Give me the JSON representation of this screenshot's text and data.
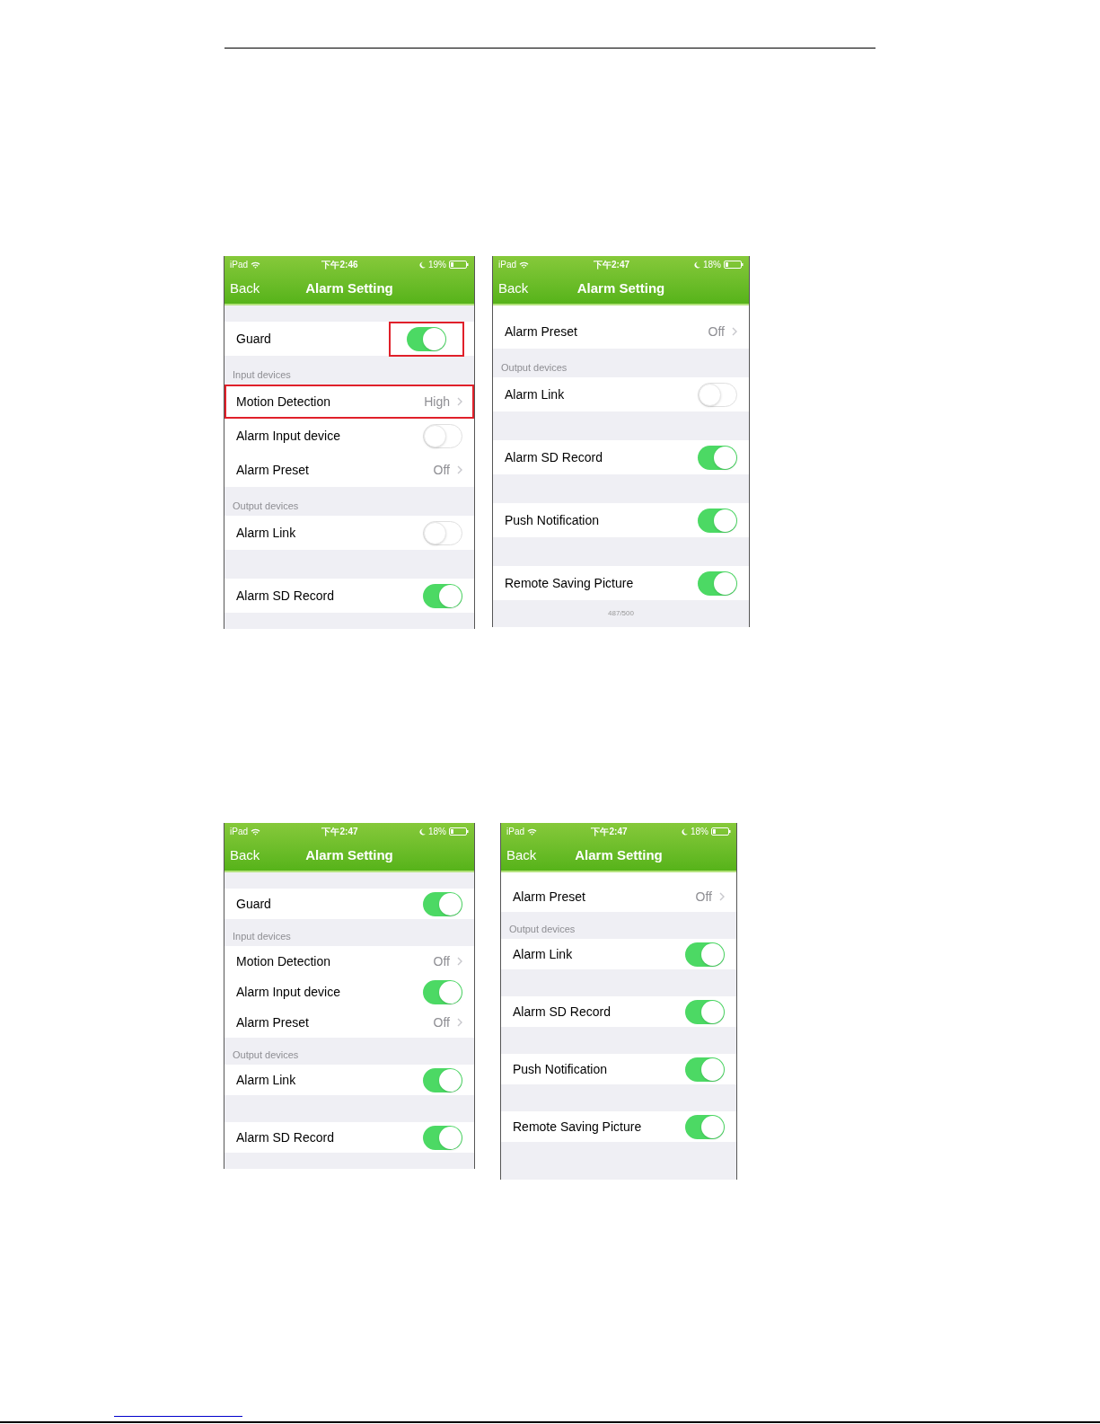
{
  "screens": [
    {
      "status": {
        "carrier": "iPad",
        "time": "下午2:46",
        "battery": "19%"
      },
      "nav": {
        "back": "Back",
        "title": "Alarm Setting"
      },
      "rows": [
        {
          "kind": "spacer"
        },
        {
          "kind": "toggle",
          "label": "Guard",
          "on": true,
          "highlighted": true
        },
        {
          "kind": "header",
          "label": "Input devices"
        },
        {
          "kind": "value",
          "label": "Motion Detection",
          "value": "High",
          "highlighted": true
        },
        {
          "kind": "toggle",
          "label": "Alarm Input device",
          "on": false,
          "highlighted": false
        },
        {
          "kind": "value",
          "label": "Alarm Preset",
          "value": "Off",
          "highlighted": false
        },
        {
          "kind": "header",
          "label": "Output devices"
        },
        {
          "kind": "toggle",
          "label": "Alarm Link",
          "on": false,
          "highlighted": false
        },
        {
          "kind": "gap"
        },
        {
          "kind": "toggle",
          "label": "Alarm SD Record",
          "on": true,
          "highlighted": false
        },
        {
          "kind": "end"
        }
      ]
    },
    {
      "status": {
        "carrier": "iPad",
        "time": "下午2:47",
        "battery": "18%"
      },
      "nav": {
        "back": "Back",
        "title": "Alarm Setting"
      },
      "rows": [
        {
          "kind": "sliver"
        },
        {
          "kind": "value",
          "label": "Alarm Preset",
          "value": "Off",
          "highlighted": false
        },
        {
          "kind": "header",
          "label": "Output devices"
        },
        {
          "kind": "toggle",
          "label": "Alarm Link",
          "on": false,
          "highlighted": false
        },
        {
          "kind": "gap"
        },
        {
          "kind": "toggle",
          "label": "Alarm SD Record",
          "on": true,
          "highlighted": false
        },
        {
          "kind": "gap"
        },
        {
          "kind": "toggle",
          "label": "Push Notification",
          "on": true,
          "highlighted": false
        },
        {
          "kind": "gap"
        },
        {
          "kind": "toggle",
          "label": "Remote Saving Picture",
          "on": true,
          "highlighted": false
        },
        {
          "kind": "footer",
          "label": "487/500"
        }
      ]
    },
    {
      "status": {
        "carrier": "iPad",
        "time": "下午2:47",
        "battery": "18%"
      },
      "nav": {
        "back": "Back",
        "title": "Alarm Setting"
      },
      "rows": [
        {
          "kind": "spacer"
        },
        {
          "kind": "toggle",
          "label": "Guard",
          "on": true,
          "highlighted": false
        },
        {
          "kind": "header",
          "label": "Input devices"
        },
        {
          "kind": "value",
          "label": "Motion Detection",
          "value": "Off",
          "highlighted": false
        },
        {
          "kind": "toggle",
          "label": "Alarm Input device",
          "on": true,
          "highlighted": false
        },
        {
          "kind": "value",
          "label": "Alarm Preset",
          "value": "Off",
          "highlighted": false
        },
        {
          "kind": "header",
          "label": "Output devices"
        },
        {
          "kind": "toggle",
          "label": "Alarm Link",
          "on": true,
          "highlighted": false
        },
        {
          "kind": "gap"
        },
        {
          "kind": "toggle",
          "label": "Alarm SD Record",
          "on": true,
          "highlighted": false
        },
        {
          "kind": "end"
        }
      ]
    },
    {
      "status": {
        "carrier": "iPad",
        "time": "下午2:47",
        "battery": "18%"
      },
      "nav": {
        "back": "Back",
        "title": "Alarm Setting"
      },
      "rows": [
        {
          "kind": "sliver"
        },
        {
          "kind": "value",
          "label": "Alarm Preset",
          "value": "Off",
          "highlighted": false
        },
        {
          "kind": "header",
          "label": "Output devices"
        },
        {
          "kind": "toggle",
          "label": "Alarm Link",
          "on": true,
          "highlighted": false
        },
        {
          "kind": "gap"
        },
        {
          "kind": "toggle",
          "label": "Alarm SD Record",
          "on": true,
          "highlighted": false
        },
        {
          "kind": "gap"
        },
        {
          "kind": "toggle",
          "label": "Push Notification",
          "on": true,
          "highlighted": false
        },
        {
          "kind": "gap"
        },
        {
          "kind": "toggle",
          "label": "Remote Saving Picture",
          "on": true,
          "highlighted": false
        },
        {
          "kind": "bottom"
        }
      ]
    }
  ]
}
